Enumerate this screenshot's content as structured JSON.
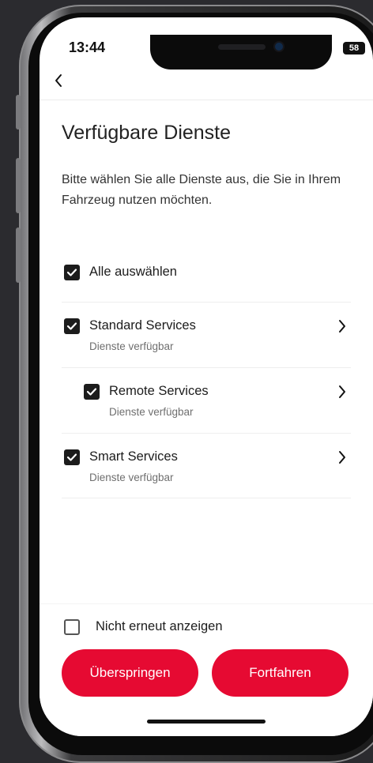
{
  "status_bar": {
    "time": "13:44",
    "battery": "58"
  },
  "header": {
    "back_icon": "chevron-left-icon"
  },
  "page": {
    "title": "Verfügbare Dienste",
    "subtitle": "Bitte wählen Sie alle Dienste aus, die Sie in Ihrem Fahrzeug nutzen möchten."
  },
  "select_all": {
    "label": "Alle auswählen",
    "checked": true
  },
  "services": [
    {
      "label": "Standard Services",
      "sub": "Dienste verfügbar",
      "checked": true
    },
    {
      "label": "Remote Services",
      "sub": "Dienste verfügbar",
      "checked": true
    },
    {
      "label": "Smart Services",
      "sub": "Dienste verfügbar",
      "checked": true
    }
  ],
  "footer": {
    "dont_show_label": "Nicht erneut anzeigen",
    "dont_show_checked": false,
    "skip_label": "Überspringen",
    "continue_label": "Fortfahren"
  },
  "colors": {
    "accent": "#e60a32",
    "checkbox": "#1c1c1c"
  }
}
